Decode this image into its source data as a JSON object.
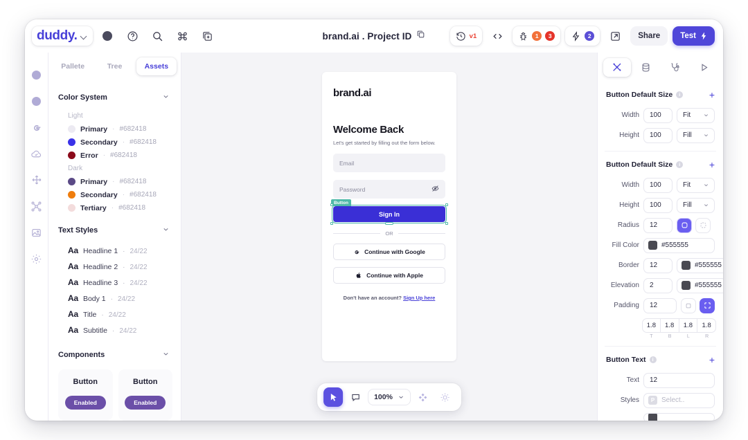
{
  "topbar": {
    "logo": "duddy.",
    "title": "brand.ai . Project ID",
    "version_label": "v1",
    "bug_badge_1": "1",
    "bug_badge_2": "3",
    "flash_badge": "2",
    "share_label": "Share",
    "test_label": "Test"
  },
  "left_panel": {
    "tabs": [
      {
        "label": "Pallete",
        "active": false
      },
      {
        "label": "Tree",
        "active": false
      },
      {
        "label": "Assets",
        "active": true
      }
    ],
    "color_system": {
      "title": "Color System",
      "groups": [
        {
          "label": "Light",
          "items": [
            {
              "name": "Primary",
              "hex": "#682418",
              "swatch": "#eceaf2"
            },
            {
              "name": "Secondary",
              "hex": "#682418",
              "swatch": "#3a32e8"
            },
            {
              "name": "Error",
              "hex": "#682418",
              "swatch": "#8b0a1a"
            }
          ]
        },
        {
          "label": "Dark",
          "items": [
            {
              "name": "Primary",
              "hex": "#682418",
              "swatch": "#5b4a86"
            },
            {
              "name": "Secondary",
              "hex": "#682418",
              "swatch": "#ef7d0d"
            },
            {
              "name": "Tertiary",
              "hex": "#682418",
              "swatch": "#f3dcdc"
            }
          ]
        }
      ]
    },
    "text_styles": {
      "title": "Text Styles",
      "items": [
        {
          "sample": "Aa",
          "name": "Headline 1",
          "size": "24/22"
        },
        {
          "sample": "Aa",
          "name": "Headline 2",
          "size": "24/22"
        },
        {
          "sample": "Aa",
          "name": "Headline 3",
          "size": "24/22"
        },
        {
          "sample": "Aa",
          "name": "Body 1",
          "size": "24/22"
        },
        {
          "sample": "Aa",
          "name": "Title",
          "size": "24/22"
        },
        {
          "sample": "Aa",
          "name": "Subtitle",
          "size": "24/22"
        }
      ]
    },
    "components": {
      "title": "Components",
      "items": [
        {
          "label": "Button",
          "state": "Enabled"
        },
        {
          "label": "Button",
          "state": "Enabled"
        }
      ]
    }
  },
  "canvas": {
    "artboard": {
      "logo": "brand.ai",
      "heading": "Welcome Back",
      "subtitle": "Let's get started by filling out the form below.",
      "email_placeholder": "Email",
      "password_placeholder": "Password",
      "selection_tag": "Button",
      "signin_label": "Sign In",
      "divider_label": "OR",
      "google_label": "Continue with Google",
      "apple_label": "Continue with Apple",
      "footer_text": "Don't have an account?",
      "footer_link": "Sign Up here"
    },
    "toolbar": {
      "zoom": "100%"
    }
  },
  "right_panel": {
    "sections": [
      {
        "title": "Button Default Size",
        "add": "+",
        "rows": [
          {
            "label": "Width",
            "value": "100",
            "mode": "Fit"
          },
          {
            "label": "Height",
            "value": "100",
            "mode": "Fill"
          }
        ]
      },
      {
        "title": "Button Default Size",
        "add": "+",
        "rows": [
          {
            "label": "Width",
            "value": "100",
            "mode": "Fit"
          },
          {
            "label": "Height",
            "value": "100",
            "mode": "Fill"
          }
        ],
        "radius": {
          "label": "Radius",
          "value": "12"
        },
        "fill_color": {
          "label": "Fill Color",
          "hex": "#555555",
          "swatch": "#4a4a52"
        },
        "border": {
          "label": "Border",
          "value": "12",
          "hex": "#555555",
          "swatch": "#4a4a52"
        },
        "elevation": {
          "label": "Elevation",
          "value": "2",
          "hex": "#555555",
          "swatch": "#4a4a52"
        },
        "padding": {
          "label": "Padding",
          "value": "12"
        },
        "padding_quad": [
          {
            "value": "1.8",
            "side": "T"
          },
          {
            "value": "1.8",
            "side": "B"
          },
          {
            "value": "1.8",
            "side": "L"
          },
          {
            "value": "1.8",
            "side": "R"
          }
        ]
      },
      {
        "title": "Button Text",
        "add": "+",
        "text_row": {
          "label": "Text",
          "value": "12"
        },
        "styles_row": {
          "label": "Styles",
          "tag": "P",
          "placeholder": "Select.."
        }
      }
    ]
  },
  "accent": "#4840d8"
}
